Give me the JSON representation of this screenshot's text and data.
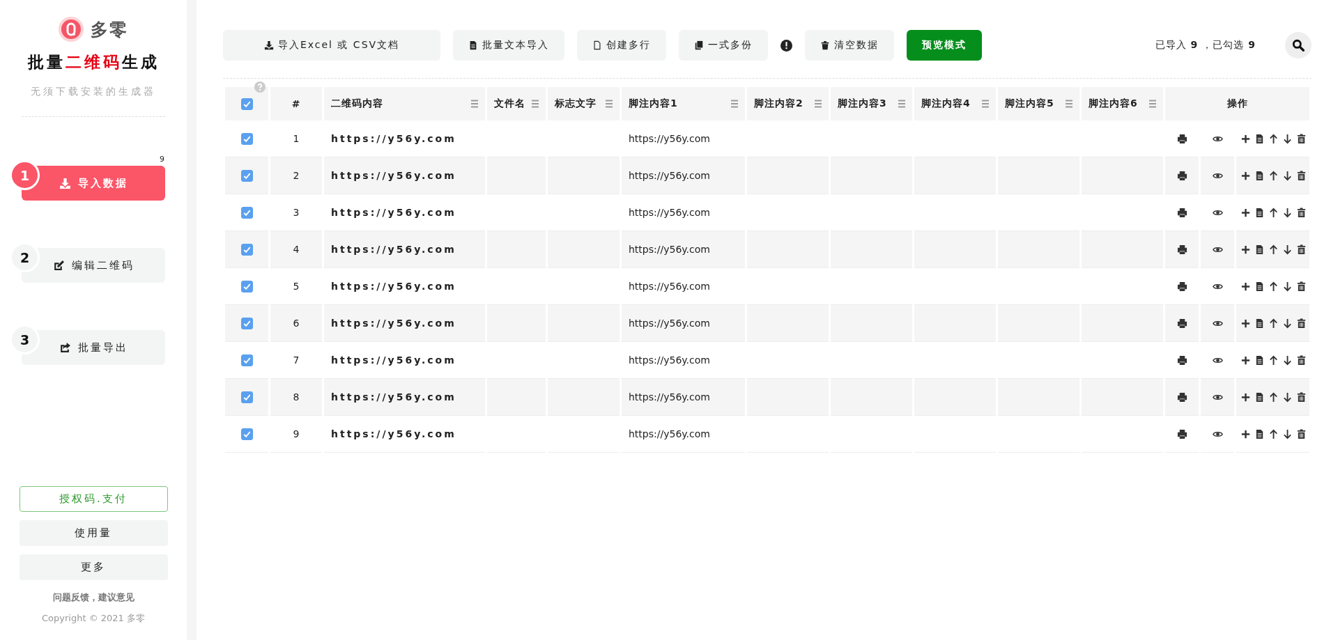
{
  "sidebar": {
    "brand": "多零",
    "title_parts": [
      {
        "text": "批量",
        "highlighted": false
      },
      {
        "text": "二维码",
        "highlighted": true
      },
      {
        "text": "生成",
        "highlighted": false
      }
    ],
    "subtitle": "无须下载安装的生成器",
    "steps": [
      {
        "number": "1",
        "label": "导入数据",
        "selected": true,
        "badge": "9"
      },
      {
        "number": "2",
        "label": "编辑二维码",
        "selected": false
      },
      {
        "number": "3",
        "label": "批量导出",
        "selected": false
      }
    ],
    "license_button": "授权码.支付",
    "usage_button": "使用量",
    "more_button": "更多",
    "feedback_link": "问题反馈，建议意见",
    "copyright": "Copyright © 2021 多零"
  },
  "toolbar": {
    "buttons": [
      {
        "label": "导入Excel 或 CSV文档",
        "kind": "import"
      },
      {
        "label": "批量文本导入",
        "kind": "text"
      },
      {
        "label": "创建多行",
        "kind": "create"
      },
      {
        "label": "一式多份",
        "kind": "duplicate"
      },
      {
        "kind": "alert"
      },
      {
        "label": "清空数据",
        "kind": "clear"
      },
      {
        "label": "预览模式",
        "kind": "preview"
      }
    ],
    "imported_label": "已导入",
    "imported_count": "9",
    "checked_label": "，已勾选",
    "checked_count": "9"
  },
  "table": {
    "select_all_checked": true,
    "columns": [
      {
        "label": "#",
        "has_menu": false
      },
      {
        "label": "二维码内容",
        "has_menu": true
      },
      {
        "label": "文件名",
        "has_menu": true
      },
      {
        "label": "标志文字",
        "has_menu": true
      },
      {
        "label": "脚注内容1",
        "has_menu": true
      },
      {
        "label": "脚注内容2",
        "has_menu": true
      },
      {
        "label": "脚注内容3",
        "has_menu": true
      },
      {
        "label": "脚注内容4",
        "has_menu": true
      },
      {
        "label": "脚注内容5",
        "has_menu": true
      },
      {
        "label": "脚注内容6",
        "has_menu": true
      },
      {
        "label": "操作",
        "has_menu": false
      }
    ],
    "rows": [
      {
        "checked": true,
        "number": "1",
        "qr_content": "https://y56y.com",
        "footnote_1": "https://y56y.com"
      },
      {
        "checked": true,
        "number": "2",
        "qr_content": "https://y56y.com",
        "footnote_1": "https://y56y.com"
      },
      {
        "checked": true,
        "number": "3",
        "qr_content": "https://y56y.com",
        "footnote_1": "https://y56y.com"
      },
      {
        "checked": true,
        "number": "4",
        "qr_content": "https://y56y.com",
        "footnote_1": "https://y56y.com"
      },
      {
        "checked": true,
        "number": "5",
        "qr_content": "https://y56y.com",
        "footnote_1": "https://y56y.com"
      },
      {
        "checked": true,
        "number": "6",
        "qr_content": "https://y56y.com",
        "footnote_1": "https://y56y.com"
      },
      {
        "checked": true,
        "number": "7",
        "qr_content": "https://y56y.com",
        "footnote_1": "https://y56y.com"
      },
      {
        "checked": true,
        "number": "8",
        "qr_content": "https://y56y.com",
        "footnote_1": "https://y56y.com"
      },
      {
        "checked": true,
        "number": "9",
        "qr_content": "https://y56y.com",
        "footnote_1": "https://y56y.com"
      }
    ]
  }
}
